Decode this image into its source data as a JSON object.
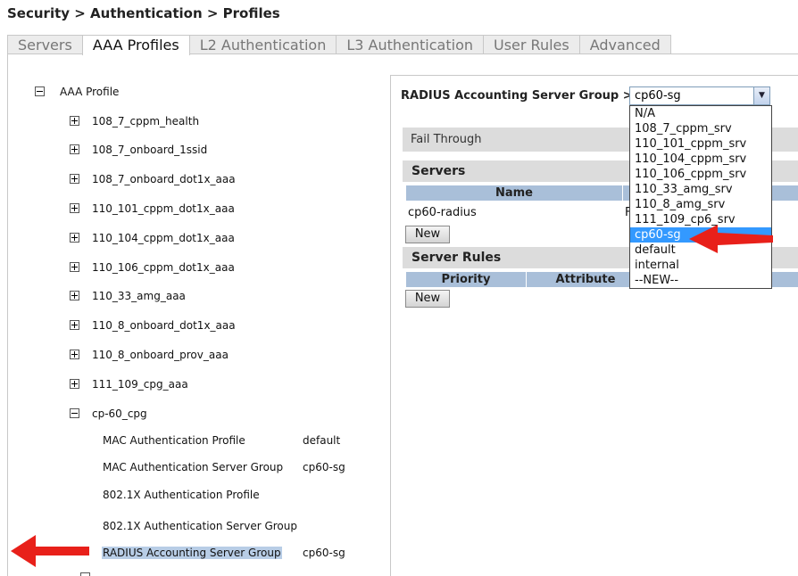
{
  "breadcrumb": "Security > Authentication > Profiles",
  "tabs": [
    {
      "label": "Servers",
      "active": false
    },
    {
      "label": "AAA Profiles",
      "active": true
    },
    {
      "label": "L2 Authentication",
      "active": false
    },
    {
      "label": "L3 Authentication",
      "active": false
    },
    {
      "label": "User Rules",
      "active": false
    },
    {
      "label": "Advanced",
      "active": false
    }
  ],
  "tree": {
    "root": "AAA Profile",
    "collapsed_profiles": [
      "108_7_cppm_health",
      "108_7_onboard_1ssid",
      "108_7_onboard_dot1x_aaa",
      "110_101_cppm_dot1x_aaa",
      "110_104_cppm_dot1x_aaa",
      "110_106_cppm_dot1x_aaa",
      "110_33_amg_aaa",
      "110_8_onboard_dot1x_aaa",
      "110_8_onboard_prov_aaa",
      "111_109_cpg_aaa"
    ],
    "expanded_profile": "cp-60_cpg",
    "children": [
      {
        "label": "MAC Authentication Profile",
        "value": "default"
      },
      {
        "label": "MAC Authentication Server Group",
        "value": "cp60-sg"
      },
      {
        "label": "802.1X Authentication Profile",
        "value": ""
      },
      {
        "label": "802.1X Authentication Server Group",
        "value": ""
      },
      {
        "label": "RADIUS Accounting Server Group",
        "value": "cp60-sg",
        "selected": true
      }
    ]
  },
  "detail": {
    "group_label": "RADIUS Accounting Server Group >",
    "select_value": "cp60-sg",
    "fail_through_label": "Fail Through",
    "servers_header": "Servers",
    "servers_columns": [
      "Name",
      ""
    ],
    "servers_rows": [
      {
        "name": "cp60-radius",
        "col2": "F"
      }
    ],
    "new_label": "New",
    "server_rules_header": "Server Rules",
    "rules_columns": [
      "Priority",
      "Attribute"
    ]
  },
  "dropdown": {
    "options": [
      "N/A",
      "108_7_cppm_srv",
      "110_101_cppm_srv",
      "110_104_cppm_srv",
      "110_106_cppm_srv",
      "110_33_amg_srv",
      "110_8_amg_srv",
      "111_109_cp6_srv",
      "cp60-sg",
      "default",
      "internal",
      "--NEW--"
    ],
    "highlighted": "cp60-sg"
  },
  "colors": {
    "annotation_arrow": "#e8201a",
    "highlight": "#3399ff",
    "table_header": "#a9bfd9"
  }
}
